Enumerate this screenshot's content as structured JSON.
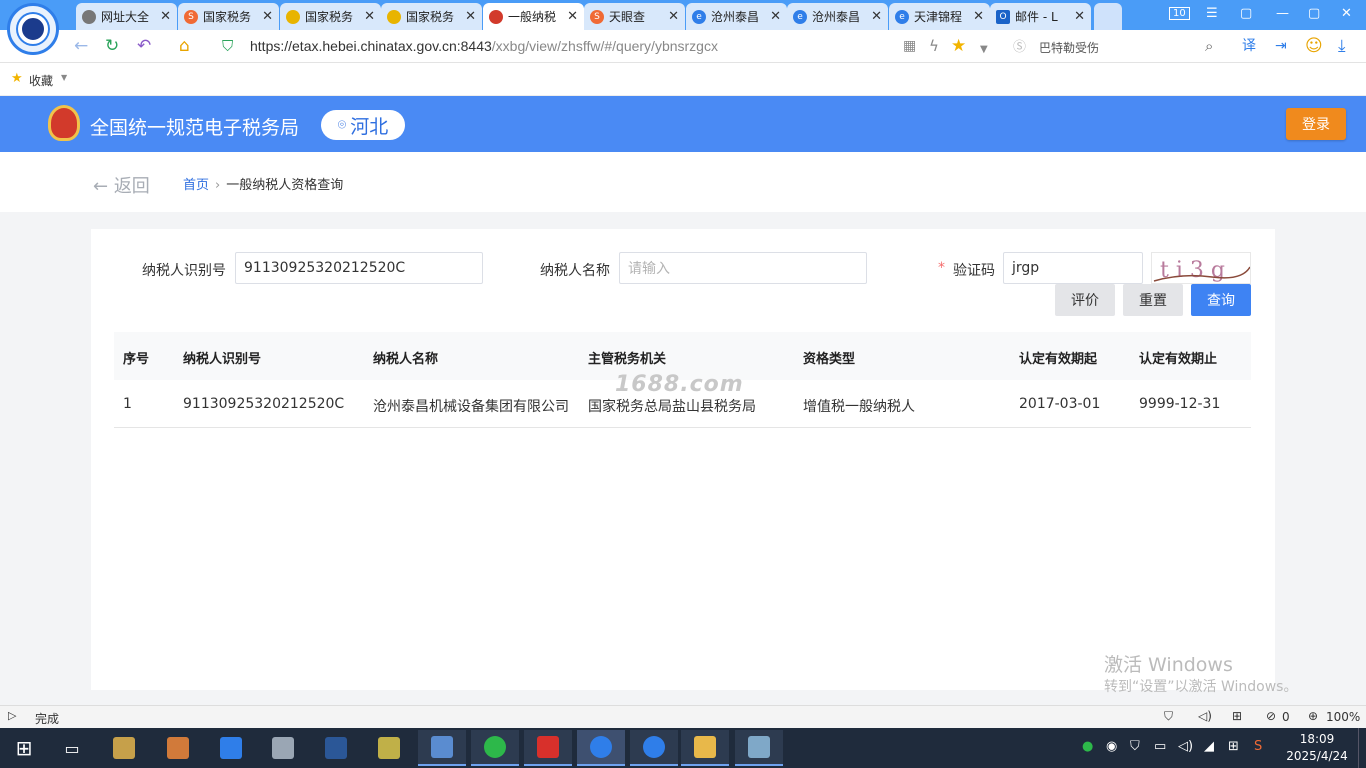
{
  "browser": {
    "tabs": [
      {
        "title": "网址大全",
        "icon_color": "#6a6a6a"
      },
      {
        "title": "国家税务",
        "icon_color": "#f06a35"
      },
      {
        "title": "国家税务",
        "icon_color": "#e8b400"
      },
      {
        "title": "国家税务",
        "icon_color": "#e8b400"
      },
      {
        "title": "一般纳税",
        "icon_color": "#d23a2b",
        "active": true
      },
      {
        "title": "天眼查",
        "icon_color": "#f06a35"
      },
      {
        "title": "沧州泰昌",
        "icon_color": "#2f7ee9"
      },
      {
        "title": "沧州泰昌",
        "icon_color": "#2f7ee9"
      },
      {
        "title": "天津锦程",
        "icon_color": "#2f7ee9"
      },
      {
        "title": "邮件 - L",
        "icon_color": "#1a63c8"
      }
    ],
    "tab_count": "10",
    "url_host": "https://etax.hebei.chinatax.gov.cn:8443",
    "url_path": "/xxbg/view/zhsffw/#/query/ybnsrzgcx",
    "search_hint": "巴特勒受伤",
    "bookmark_label": "收藏",
    "status_text": "完成",
    "status_zero": "0",
    "zoom": "100%"
  },
  "site": {
    "title": "全国统一规范电子税务局",
    "region": "河北",
    "login": "登录",
    "back": "返回",
    "breadcrumb_home": "首页",
    "breadcrumb_current": "一般纳税人资格查询"
  },
  "form": {
    "taxid_label": "纳税人识别号",
    "taxid_value": "91130925320212520C",
    "name_label": "纳税人名称",
    "name_placeholder": "请输入",
    "captcha_label": "验证码",
    "captcha_value": "jrgp",
    "captcha_image_text": "t i 3 g",
    "btn_rate": "评价",
    "btn_reset": "重置",
    "btn_query": "查询"
  },
  "table": {
    "headers": [
      "序号",
      "纳税人识别号",
      "纳税人名称",
      "主管税务机关",
      "资格类型",
      "认定有效期起",
      "认定有效期止"
    ],
    "rows": [
      [
        "1",
        "91130925320212520C",
        "沧州泰昌机械设备集团有限公司",
        "国家税务总局盐山县税务局",
        "增值税一般纳税人",
        "2017-03-01",
        "9999-12-31"
      ]
    ]
  },
  "overlay": {
    "watermark": "1688.com",
    "activate_title": "激活 Windows",
    "activate_sub": "转到“设置”以激活 Windows。"
  },
  "taskbar": {
    "time": "18:09",
    "date": "2025/4/24"
  }
}
